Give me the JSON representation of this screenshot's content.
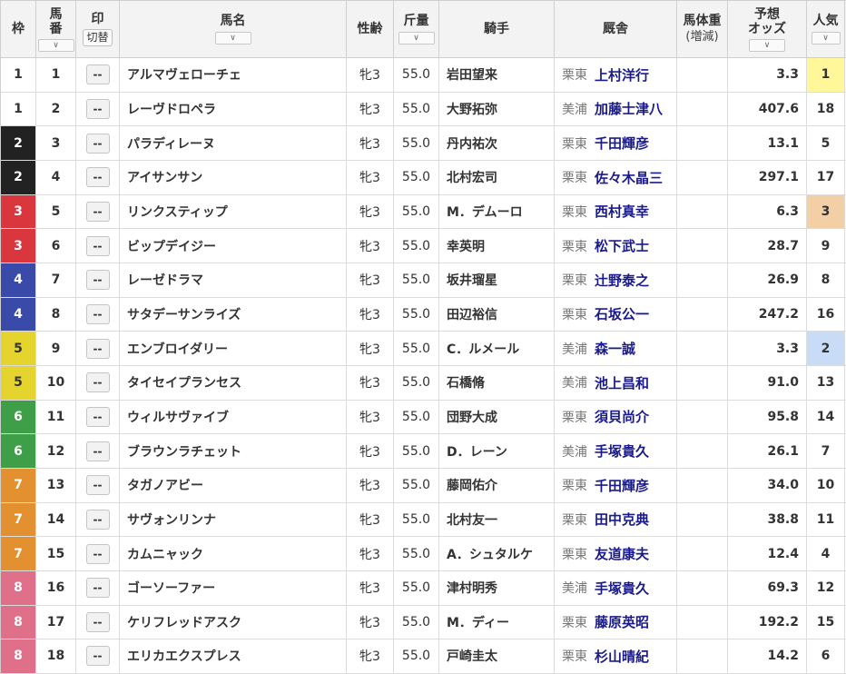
{
  "header": {
    "waku": "枠",
    "umaban": "馬\n番",
    "mark": "印",
    "mark_switch": "切替",
    "name": "馬名",
    "sex_age": "性齢",
    "weight": "斤量",
    "jockey": "騎手",
    "stable": "厩舎",
    "body_weight": "馬体重",
    "body_weight_sub": "(増減)",
    "odds": "予想\nオッズ",
    "popularity": "人気"
  },
  "mark_placeholder": "--",
  "colors": {
    "waku_1": "#ffffff",
    "waku_2": "#222222",
    "waku_3": "#d9363e",
    "waku_4": "#3a4aa8",
    "waku_5": "#e6d42e",
    "waku_6": "#3f9e48",
    "waku_7": "#e39130",
    "waku_8": "#e0708a",
    "pop_1": "#fff79a",
    "pop_2": "#c9dcf7",
    "pop_3": "#f3cfa6",
    "odds_highlight": "#d34b5a"
  },
  "rows": [
    {
      "waku": "1",
      "num": "1",
      "name": "アルマヴェローチェ",
      "sex": "牝3",
      "wt": "55.0",
      "jockey": "岩田望来",
      "region": "栗東",
      "trainer": "上村洋行",
      "odds": "3.3",
      "pop": "1"
    },
    {
      "waku": "1",
      "num": "2",
      "name": "レーヴドロペラ",
      "sex": "牝3",
      "wt": "55.0",
      "jockey": "大野拓弥",
      "region": "美浦",
      "trainer": "加藤士津八",
      "odds": "407.6",
      "pop": "18"
    },
    {
      "waku": "2",
      "num": "3",
      "name": "パラディレーヌ",
      "sex": "牝3",
      "wt": "55.0",
      "jockey": "丹内祐次",
      "region": "栗東",
      "trainer": "千田輝彦",
      "odds": "13.1",
      "pop": "5"
    },
    {
      "waku": "2",
      "num": "4",
      "name": "アイサンサン",
      "sex": "牝3",
      "wt": "55.0",
      "jockey": "北村宏司",
      "region": "栗東",
      "trainer": "佐々木晶三",
      "odds": "297.1",
      "pop": "17"
    },
    {
      "waku": "3",
      "num": "5",
      "name": "リンクスティップ",
      "sex": "牝3",
      "wt": "55.0",
      "jockey": "M．デムーロ",
      "region": "栗東",
      "trainer": "西村真幸",
      "odds": "6.3",
      "pop": "3"
    },
    {
      "waku": "3",
      "num": "6",
      "name": "ビップデイジー",
      "sex": "牝3",
      "wt": "55.0",
      "jockey": "幸英明",
      "region": "栗東",
      "trainer": "松下武士",
      "odds": "28.7",
      "pop": "9"
    },
    {
      "waku": "4",
      "num": "7",
      "name": "レーゼドラマ",
      "sex": "牝3",
      "wt": "55.0",
      "jockey": "坂井瑠星",
      "region": "栗東",
      "trainer": "辻野泰之",
      "odds": "26.9",
      "pop": "8"
    },
    {
      "waku": "4",
      "num": "8",
      "name": "サタデーサンライズ",
      "sex": "牝3",
      "wt": "55.0",
      "jockey": "田辺裕信",
      "region": "栗東",
      "trainer": "石坂公一",
      "odds": "247.2",
      "pop": "16"
    },
    {
      "waku": "5",
      "num": "9",
      "name": "エンブロイダリー",
      "sex": "牝3",
      "wt": "55.0",
      "jockey": "C．ルメール",
      "region": "美浦",
      "trainer": "森一誠",
      "odds": "3.3",
      "pop": "2"
    },
    {
      "waku": "5",
      "num": "10",
      "name": "タイセイプランセス",
      "sex": "牝3",
      "wt": "55.0",
      "jockey": "石橋脩",
      "region": "美浦",
      "trainer": "池上昌和",
      "odds": "91.0",
      "pop": "13"
    },
    {
      "waku": "6",
      "num": "11",
      "name": "ウィルサヴァイブ",
      "sex": "牝3",
      "wt": "55.0",
      "jockey": "団野大成",
      "region": "栗東",
      "trainer": "須貝尚介",
      "odds": "95.8",
      "pop": "14"
    },
    {
      "waku": "6",
      "num": "12",
      "name": "ブラウンラチェット",
      "sex": "牝3",
      "wt": "55.0",
      "jockey": "D．レーン",
      "region": "美浦",
      "trainer": "手塚貴久",
      "odds": "26.1",
      "pop": "7"
    },
    {
      "waku": "7",
      "num": "13",
      "name": "タガノアビー",
      "sex": "牝3",
      "wt": "55.0",
      "jockey": "藤岡佑介",
      "region": "栗東",
      "trainer": "千田輝彦",
      "odds": "34.0",
      "pop": "10"
    },
    {
      "waku": "7",
      "num": "14",
      "name": "サヴォンリンナ",
      "sex": "牝3",
      "wt": "55.0",
      "jockey": "北村友一",
      "region": "栗東",
      "trainer": "田中克典",
      "odds": "38.8",
      "pop": "11"
    },
    {
      "waku": "7",
      "num": "15",
      "name": "カムニャック",
      "sex": "牝3",
      "wt": "55.0",
      "jockey": "A．シュタルケ",
      "region": "栗東",
      "trainer": "友道康夫",
      "odds": "12.4",
      "pop": "4"
    },
    {
      "waku": "8",
      "num": "16",
      "name": "ゴーソーファー",
      "sex": "牝3",
      "wt": "55.0",
      "jockey": "津村明秀",
      "region": "美浦",
      "trainer": "手塚貴久",
      "odds": "69.3",
      "pop": "12"
    },
    {
      "waku": "8",
      "num": "17",
      "name": "ケリフレッドアスク",
      "sex": "牝3",
      "wt": "55.0",
      "jockey": "M．ディー",
      "region": "栗東",
      "trainer": "藤原英昭",
      "odds": "192.2",
      "pop": "15"
    },
    {
      "waku": "8",
      "num": "18",
      "name": "エリカエクスプレス",
      "sex": "牝3",
      "wt": "55.0",
      "jockey": "戸崎圭太",
      "region": "栗東",
      "trainer": "杉山晴紀",
      "odds": "14.2",
      "pop": "6"
    }
  ]
}
